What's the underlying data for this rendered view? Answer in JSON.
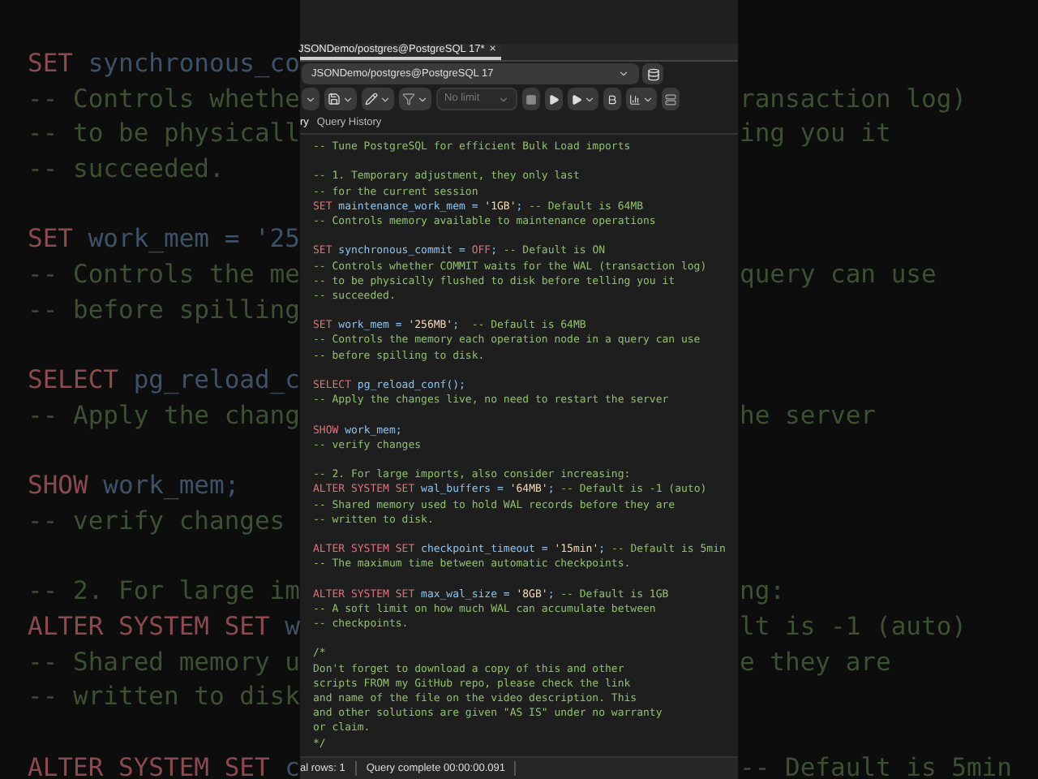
{
  "backdrop": [
    {
      "left": [
        {
          "kind": "keyword",
          "text": "SET "
        },
        {
          "kind": "ident",
          "text": "synchronous_co"
        }
      ]
    },
    {
      "left": [
        {
          "kind": "comment",
          "text": "-- Controls whethe"
        }
      ],
      "right": [
        {
          "kind": "comment",
          "text": "ransaction log)"
        }
      ]
    },
    {
      "left": [
        {
          "kind": "comment",
          "text": "-- to be physicall"
        }
      ],
      "right": [
        {
          "kind": "comment",
          "text": "ing you it"
        }
      ]
    },
    {
      "left": [
        {
          "kind": "comment",
          "text": "-- succeeded."
        }
      ]
    },
    {
      "kind": "blank"
    },
    {
      "left": [
        {
          "kind": "keyword",
          "text": "SET "
        },
        {
          "kind": "ident",
          "text": "work_mem = '25"
        }
      ]
    },
    {
      "left": [
        {
          "kind": "comment",
          "text": "-- Controls the me"
        }
      ],
      "right": [
        {
          "kind": "comment",
          "text": "query can use"
        }
      ]
    },
    {
      "left": [
        {
          "kind": "comment",
          "text": "-- before spilling"
        }
      ]
    },
    {
      "kind": "blank"
    },
    {
      "left": [
        {
          "kind": "keyword",
          "text": "SELECT "
        },
        {
          "kind": "ident",
          "text": "pg_reload_c"
        }
      ]
    },
    {
      "left": [
        {
          "kind": "comment",
          "text": "-- Apply the chang"
        }
      ],
      "right": [
        {
          "kind": "comment",
          "text": "he server"
        }
      ]
    },
    {
      "kind": "blank"
    },
    {
      "left": [
        {
          "kind": "keyword",
          "text": "SHOW "
        },
        {
          "kind": "ident",
          "text": "work_mem;"
        }
      ]
    },
    {
      "left": [
        {
          "kind": "comment",
          "text": "-- verify changes"
        }
      ]
    },
    {
      "kind": "blank"
    },
    {
      "left": [
        {
          "kind": "comment",
          "text": "-- 2. For large im"
        }
      ],
      "right": [
        {
          "kind": "comment",
          "text": "ng:"
        }
      ]
    },
    {
      "left": [
        {
          "kind": "keyword",
          "text": "ALTER SYSTEM SET "
        },
        {
          "kind": "ident",
          "text": "w"
        }
      ],
      "right": [
        {
          "kind": "comment",
          "text": "lt is -1 (auto)"
        }
      ]
    },
    {
      "left": [
        {
          "kind": "comment",
          "text": "-- Shared memory u"
        }
      ],
      "right": [
        {
          "kind": "comment",
          "text": "e they are"
        }
      ]
    },
    {
      "left": [
        {
          "kind": "comment",
          "text": "-- written to disk"
        }
      ]
    },
    {
      "kind": "blank"
    },
    {
      "left": [
        {
          "kind": "keyword",
          "text": "ALTER SYSTEM SET "
        },
        {
          "kind": "ident",
          "text": "c"
        }
      ],
      "right": [
        {
          "kind": "comment",
          "text": "-- Default is 5min"
        }
      ]
    }
  ],
  "editor_tab": {
    "title": "JSONDemo/postgres@PostgreSQL 17*",
    "close": "×"
  },
  "connection": {
    "value": "JSONDemo/postgres@PostgreSQL 17"
  },
  "toolbar": {
    "limit": "No limit"
  },
  "query_tabs": [
    {
      "label": "ry",
      "selected": true
    },
    {
      "label": "Query History",
      "selected": false
    }
  ],
  "code": [
    {
      "tokens": [
        {
          "kind": "comment",
          "text": "-- Tune PostgreSQL for efficient Bulk Load imports"
        }
      ]
    },
    {
      "kind": "blank"
    },
    {
      "tokens": [
        {
          "kind": "comment",
          "text": "-- 1. Temporary adjustment, they only last"
        }
      ]
    },
    {
      "tokens": [
        {
          "kind": "comment",
          "text": "-- for the current session"
        }
      ]
    },
    {
      "tokens": [
        {
          "kind": "keyword",
          "text": "SET "
        },
        {
          "kind": "ident",
          "text": "maintenance_work_mem = "
        },
        {
          "kind": "string",
          "text": "'1GB'"
        },
        {
          "kind": "ident",
          "text": "; "
        },
        {
          "kind": "comment",
          "text": "-- Default is 64MB"
        }
      ]
    },
    {
      "tokens": [
        {
          "kind": "comment",
          "text": "-- Controls memory available to maintenance operations"
        }
      ]
    },
    {
      "kind": "blank"
    },
    {
      "tokens": [
        {
          "kind": "keyword",
          "text": "SET "
        },
        {
          "kind": "ident",
          "text": "synchronous_commit = "
        },
        {
          "kind": "keyword",
          "text": "OFF"
        },
        {
          "kind": "ident",
          "text": "; "
        },
        {
          "kind": "comment",
          "text": "-- Default is ON"
        }
      ]
    },
    {
      "tokens": [
        {
          "kind": "comment",
          "text": "-- Controls whether COMMIT waits for the WAL (transaction log)"
        }
      ]
    },
    {
      "tokens": [
        {
          "kind": "comment",
          "text": "-- to be physically flushed to disk before telling you it"
        }
      ]
    },
    {
      "tokens": [
        {
          "kind": "comment",
          "text": "-- succeeded."
        }
      ]
    },
    {
      "kind": "blank"
    },
    {
      "tokens": [
        {
          "kind": "keyword",
          "text": "SET "
        },
        {
          "kind": "ident",
          "text": "work_mem = "
        },
        {
          "kind": "string",
          "text": "'256MB'"
        },
        {
          "kind": "ident",
          "text": ";  "
        },
        {
          "kind": "comment",
          "text": "-- Default is 64MB"
        }
      ]
    },
    {
      "tokens": [
        {
          "kind": "comment",
          "text": "-- Controls the memory each operation node in a query can use"
        }
      ]
    },
    {
      "tokens": [
        {
          "kind": "comment",
          "text": "-- before spilling to disk."
        }
      ]
    },
    {
      "kind": "blank"
    },
    {
      "tokens": [
        {
          "kind": "keyword",
          "text": "SELECT "
        },
        {
          "kind": "ident",
          "text": "pg_reload_conf();"
        }
      ]
    },
    {
      "tokens": [
        {
          "kind": "comment",
          "text": "-- Apply the changes live, no need to restart the server"
        }
      ]
    },
    {
      "kind": "blank"
    },
    {
      "tokens": [
        {
          "kind": "keyword",
          "text": "SHOW "
        },
        {
          "kind": "ident",
          "text": "work_mem;"
        }
      ]
    },
    {
      "tokens": [
        {
          "kind": "comment",
          "text": "-- verify changes"
        }
      ]
    },
    {
      "kind": "blank"
    },
    {
      "tokens": [
        {
          "kind": "comment",
          "text": "-- 2. For large imports, also consider increasing:"
        }
      ]
    },
    {
      "tokens": [
        {
          "kind": "keyword",
          "text": "ALTER SYSTEM SET "
        },
        {
          "kind": "ident",
          "text": "wal_buffers = "
        },
        {
          "kind": "string",
          "text": "'64MB'"
        },
        {
          "kind": "ident",
          "text": "; "
        },
        {
          "kind": "comment",
          "text": "-- Default is -1 (auto)"
        }
      ]
    },
    {
      "tokens": [
        {
          "kind": "comment",
          "text": "-- Shared memory used to hold WAL records before they are"
        }
      ]
    },
    {
      "tokens": [
        {
          "kind": "comment",
          "text": "-- written to disk."
        }
      ]
    },
    {
      "kind": "blank"
    },
    {
      "tokens": [
        {
          "kind": "keyword",
          "text": "ALTER SYSTEM SET "
        },
        {
          "kind": "ident",
          "text": "checkpoint_timeout = "
        },
        {
          "kind": "string",
          "text": "'15min'"
        },
        {
          "kind": "ident",
          "text": "; "
        },
        {
          "kind": "comment",
          "text": "-- Default is 5min"
        }
      ]
    },
    {
      "tokens": [
        {
          "kind": "comment",
          "text": "-- The maximum time between automatic checkpoints."
        }
      ]
    },
    {
      "kind": "blank"
    },
    {
      "tokens": [
        {
          "kind": "keyword",
          "text": "ALTER SYSTEM SET "
        },
        {
          "kind": "ident",
          "text": "max_wal_size = "
        },
        {
          "kind": "string",
          "text": "'8GB'"
        },
        {
          "kind": "ident",
          "text": "; "
        },
        {
          "kind": "comment",
          "text": "-- Default is 1GB"
        }
      ]
    },
    {
      "tokens": [
        {
          "kind": "comment",
          "text": "-- A soft limit on how much WAL can accumulate between"
        }
      ]
    },
    {
      "tokens": [
        {
          "kind": "comment",
          "text": "-- checkpoints."
        }
      ]
    },
    {
      "kind": "blank"
    },
    {
      "tokens": [
        {
          "kind": "comment",
          "text": "/*"
        }
      ]
    },
    {
      "tokens": [
        {
          "kind": "comment",
          "text": "Don't forget to download a copy of this and other"
        }
      ]
    },
    {
      "tokens": [
        {
          "kind": "comment",
          "text": "scripts FROM my GitHub repo, please check the link"
        }
      ]
    },
    {
      "tokens": [
        {
          "kind": "comment",
          "text": "and name of the file on the video description. This"
        }
      ]
    },
    {
      "tokens": [
        {
          "kind": "comment",
          "text": "and other solutions are given \"AS IS\" under no warranty"
        }
      ]
    },
    {
      "tokens": [
        {
          "kind": "comment",
          "text": "or claim."
        }
      ]
    },
    {
      "tokens": [
        {
          "kind": "comment",
          "text": "*/"
        }
      ]
    }
  ],
  "status_bar": {
    "rows": "al rows: 1",
    "message": "Query complete 00:00:00.091"
  }
}
